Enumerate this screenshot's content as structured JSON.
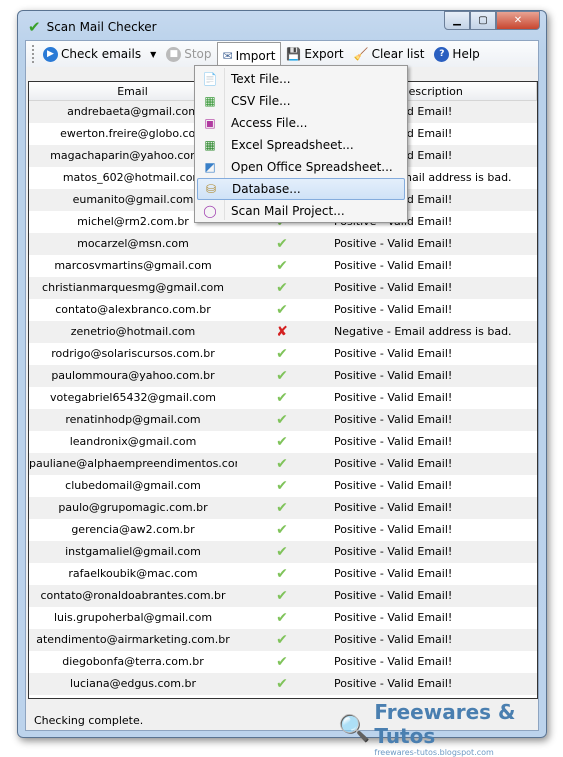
{
  "window": {
    "title": "Scan Mail Checker",
    "icon": "checkmark-icon"
  },
  "toolbar": {
    "check": "Check emails",
    "stop": "Stop",
    "import": "Import",
    "export": "Export",
    "clear": "Clear list",
    "help": "Help"
  },
  "import_menu": [
    {
      "label": "Text File...",
      "icon": "text-file-icon"
    },
    {
      "label": "CSV File...",
      "icon": "csv-file-icon"
    },
    {
      "label": "Access File...",
      "icon": "access-file-icon"
    },
    {
      "label": "Excel Spreadsheet...",
      "icon": "excel-icon"
    },
    {
      "label": "Open Office Spreadsheet...",
      "icon": "openoffice-icon"
    },
    {
      "label": "Database...",
      "icon": "database-icon",
      "highlighted": true
    },
    {
      "label": "Scan Mail Project...",
      "icon": "project-icon"
    }
  ],
  "table": {
    "columns": [
      "Email",
      "",
      "Description"
    ],
    "rows": [
      {
        "email": "andrebaeta@gmail.com",
        "valid": true,
        "desc": "Positive - Valid Email!"
      },
      {
        "email": "ewerton.freire@globo.com",
        "valid": true,
        "desc": "Positive - Valid Email!"
      },
      {
        "email": "magachaparin@yahoo.com.br",
        "valid": true,
        "desc": "Positive - Valid Email!"
      },
      {
        "email": "matos_602@hotmail.com",
        "valid": false,
        "desc": "Negative - Email address is bad."
      },
      {
        "email": "eumanito@gmail.com",
        "valid": true,
        "desc": "Positive - Valid Email!"
      },
      {
        "email": "michel@rm2.com.br",
        "valid": true,
        "desc": "Positive - Valid Email!"
      },
      {
        "email": "mocarzel@msn.com",
        "valid": true,
        "desc": "Positive - Valid Email!"
      },
      {
        "email": "marcosvmartins@gmail.com",
        "valid": true,
        "desc": "Positive - Valid Email!"
      },
      {
        "email": "christianmarquesmg@gmail.com",
        "valid": true,
        "desc": "Positive - Valid Email!"
      },
      {
        "email": "contato@alexbranco.com.br",
        "valid": true,
        "desc": "Positive - Valid Email!"
      },
      {
        "email": "zenetrio@hotmail.com",
        "valid": false,
        "desc": "Negative - Email address is bad."
      },
      {
        "email": "rodrigo@solariscursos.com.br",
        "valid": true,
        "desc": "Positive - Valid Email!"
      },
      {
        "email": "paulommoura@yahoo.com.br",
        "valid": true,
        "desc": "Positive - Valid Email!"
      },
      {
        "email": "votegabriel65432@gmail.com",
        "valid": true,
        "desc": "Positive - Valid Email!"
      },
      {
        "email": "renatinhodp@gmail.com",
        "valid": true,
        "desc": "Positive - Valid Email!"
      },
      {
        "email": "leandronix@gmail.com",
        "valid": true,
        "desc": "Positive - Valid Email!"
      },
      {
        "email": "pauliane@alphaempreendimentos.com",
        "valid": true,
        "desc": "Positive - Valid Email!"
      },
      {
        "email": "clubedomail@gmail.com",
        "valid": true,
        "desc": "Positive - Valid Email!"
      },
      {
        "email": "paulo@grupomagic.com.br",
        "valid": true,
        "desc": "Positive - Valid Email!"
      },
      {
        "email": "gerencia@aw2.com.br",
        "valid": true,
        "desc": "Positive - Valid Email!"
      },
      {
        "email": "instgamaliel@gmail.com",
        "valid": true,
        "desc": "Positive - Valid Email!"
      },
      {
        "email": "rafaelkoubik@mac.com",
        "valid": true,
        "desc": "Positive - Valid Email!"
      },
      {
        "email": "contato@ronaldoabrantes.com.br",
        "valid": true,
        "desc": "Positive - Valid Email!"
      },
      {
        "email": "luis.grupoherbal@gmail.com",
        "valid": true,
        "desc": "Positive - Valid Email!"
      },
      {
        "email": "atendimento@airmarketing.com.br",
        "valid": true,
        "desc": "Positive - Valid Email!"
      },
      {
        "email": "diegobonfa@terra.com.br",
        "valid": true,
        "desc": "Positive - Valid Email!"
      },
      {
        "email": "luciana@edgus.com.br",
        "valid": true,
        "desc": "Positive - Valid Email!"
      }
    ]
  },
  "status": "Checking complete.",
  "watermark": {
    "name": "Freewares & Tutos",
    "url": "freewares-tutos.blogspot.com"
  },
  "colors": {
    "valid": "#7fc35a",
    "invalid": "#d42020",
    "highlight": "#cfe2f7"
  }
}
